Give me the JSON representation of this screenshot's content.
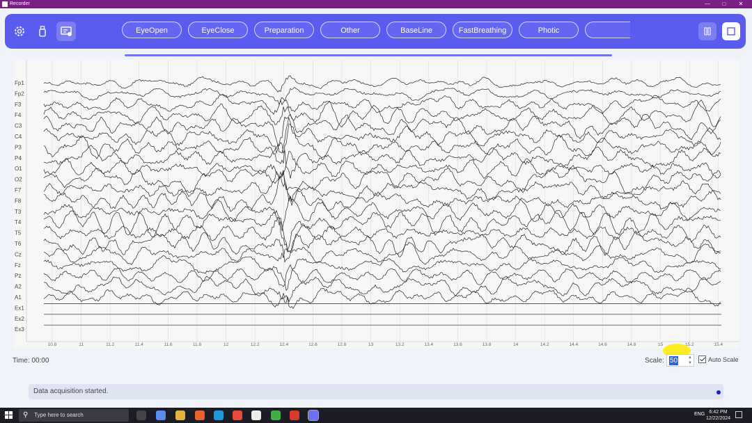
{
  "window": {
    "title": "Recorder"
  },
  "toolbar": {
    "icons": [
      "gear-icon",
      "usb-icon",
      "monitor-check-icon"
    ],
    "tabs": [
      "EyeOpen",
      "EyeClose",
      "Preparation",
      "Other",
      "BaseLine",
      "FastBreathing",
      "Photic",
      ""
    ],
    "right_buttons": [
      "pause-icon",
      "stop-icon"
    ],
    "accent": "#5a5cf0"
  },
  "plot": {
    "channels": [
      "Fp1",
      "Fp2",
      "F3",
      "F4",
      "C3",
      "C4",
      "P3",
      "P4",
      "O1",
      "O2",
      "F7",
      "F8",
      "T3",
      "T4",
      "T5",
      "T6",
      "Cz",
      "Fz",
      "Pz",
      "A2",
      "A1",
      "Ex1",
      "Ex2",
      "Ex3"
    ],
    "x_ticks": [
      "10.8",
      "11",
      "11.2",
      "11.4",
      "11.6",
      "11.8",
      "12",
      "12.2",
      "12.4",
      "12.6",
      "12.8",
      "13",
      "13.2",
      "13.4",
      "13.6",
      "13.8",
      "14",
      "14.2",
      "14.4",
      "14.6",
      "14.8",
      "15",
      "15.2",
      "15.4"
    ],
    "trace_color": "#222222"
  },
  "footer": {
    "time_label": "Time: 00:00",
    "scale_label": "Scale:",
    "scale_value": "50",
    "auto_scale_label": "Auto Scale",
    "auto_scale_checked": true,
    "status_message": "Data acquisition started."
  },
  "taskbar": {
    "search_placeholder": "Type here to search",
    "language": "ENG",
    "time": "6:42 PM",
    "date": "12/22/2024"
  }
}
